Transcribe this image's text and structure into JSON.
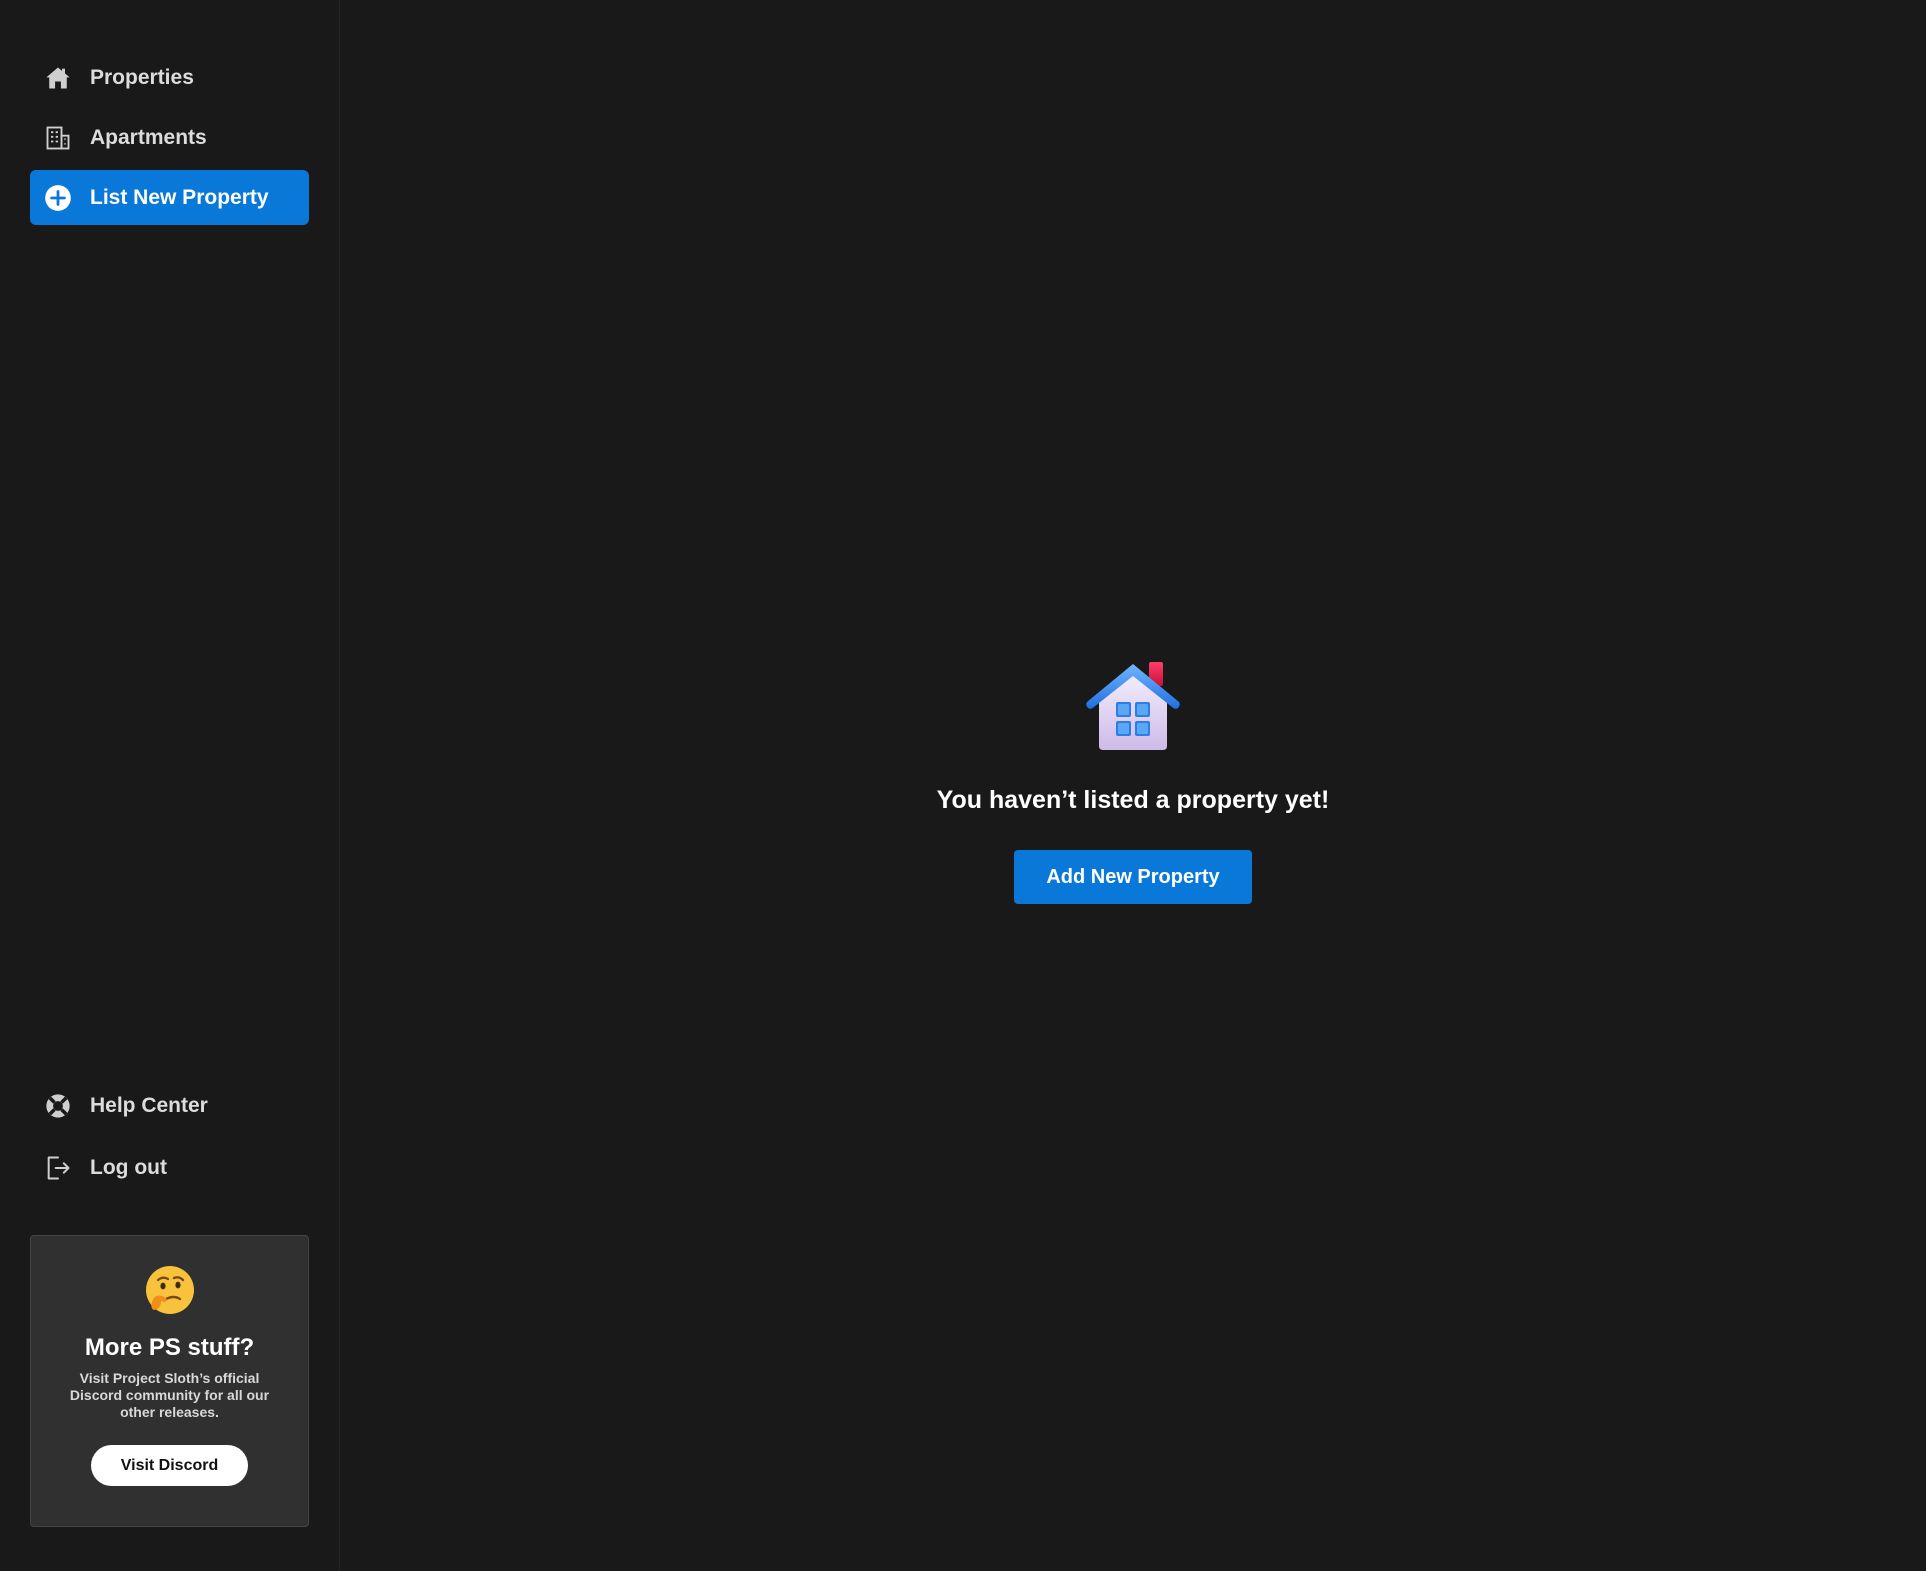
{
  "sidebar": {
    "nav": [
      {
        "label": "Properties",
        "icon": "home-icon",
        "active": false
      },
      {
        "label": "Apartments",
        "icon": "building-icon",
        "active": false
      },
      {
        "label": "List New Property",
        "icon": "plus-circle-icon",
        "active": true
      }
    ],
    "bottom_nav": [
      {
        "label": "Help Center",
        "icon": "lifebuoy-icon"
      },
      {
        "label": "Log out",
        "icon": "logout-icon"
      }
    ],
    "promo": {
      "emoji_icon": "thinking-face-icon",
      "title": "More PS stuff?",
      "text": "Visit Project Sloth’s official Discord community for all our other releases.",
      "button_label": "Visit Discord"
    }
  },
  "main": {
    "empty_state": {
      "icon": "house-icon",
      "title": "You haven’t listed a property yet!",
      "button_label": "Add New Property"
    }
  },
  "colors": {
    "background": "#191919",
    "accent": "#0a78d8",
    "card": "#303030"
  }
}
